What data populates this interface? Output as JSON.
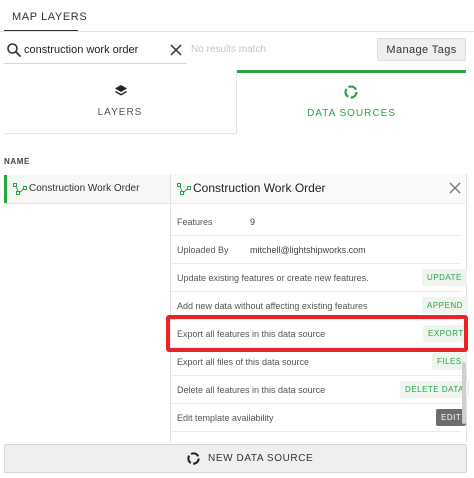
{
  "top_tab": {
    "label": "MAP LAYERS"
  },
  "search": {
    "value": "construction work order",
    "no_results": "No results match",
    "manage_tags_label": "Manage Tags"
  },
  "tabs": [
    {
      "label": "LAYERS",
      "icon": "layers-icon",
      "active": false
    },
    {
      "label": "DATA SOURCES",
      "icon": "data-sources-icon",
      "active": true
    }
  ],
  "list": {
    "header": "NAME",
    "items": [
      {
        "label": "Construction Work Order",
        "icon": "geometry-icon"
      }
    ]
  },
  "detail": {
    "title": "Construction Work Order",
    "info": [
      {
        "label": "Features",
        "value": "9"
      },
      {
        "label": "Uploaded By",
        "value": "mitchell@lightshipworks.com"
      }
    ],
    "actions": [
      {
        "label": "Update existing features or create new features.",
        "button": "UPDATE"
      },
      {
        "label": "Add new data without affecting existing features",
        "button": "APPEND"
      },
      {
        "label": "Export all features in this data source",
        "button": "EXPORT",
        "highlighted": true
      },
      {
        "label": "Export all files of this data source",
        "button": "FILES"
      },
      {
        "label": "Delete all features in this data source",
        "button": "DELETE DATA"
      },
      {
        "label": "Edit template availability",
        "button": "EDIT"
      }
    ]
  },
  "footer": {
    "new_data_source_label": "NEW DATA SOURCE"
  },
  "colors": {
    "accent": "#27a642",
    "highlight": "#e8242b"
  }
}
